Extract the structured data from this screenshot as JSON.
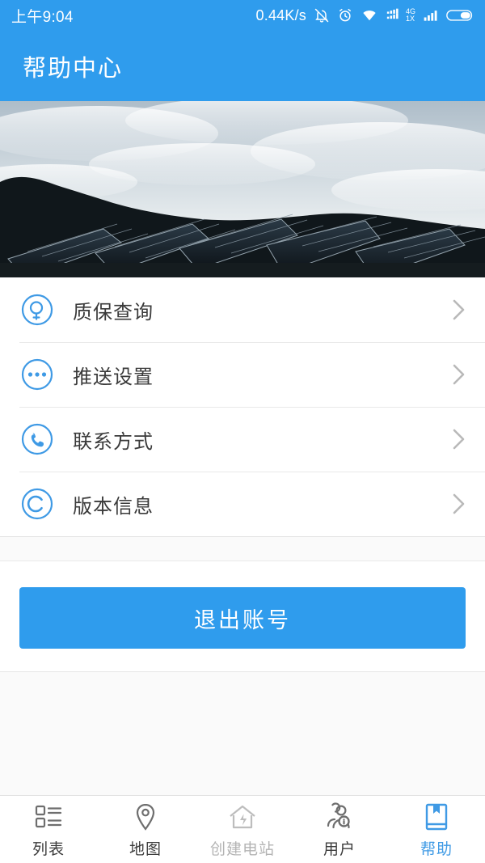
{
  "statusbar": {
    "time": "上午9:04",
    "net_speed": "0.44K/s",
    "icons": [
      "bell-muted-icon",
      "alarm-icon",
      "wifi-icon",
      "signal-1-icon",
      "signal-2-icon",
      "battery-icon"
    ],
    "network_label_top": "4G",
    "network_label_bottom": "1X"
  },
  "header": {
    "title": "帮助中心",
    "background_color": "#2f9ced"
  },
  "banner": {
    "alt": "solar-panel-farm-photo"
  },
  "menu": {
    "items": [
      {
        "label": "质保查询",
        "icon": "search-circle-icon"
      },
      {
        "label": "推送设置",
        "icon": "dots-circle-icon"
      },
      {
        "label": "联系方式",
        "icon": "phone-circle-icon"
      },
      {
        "label": "版本信息",
        "icon": "copyright-circle-icon"
      }
    ],
    "chevron_icon": "chevron-right-icon",
    "icon_color": "#3f9ae5",
    "label_color": "#3a3a3a"
  },
  "logout": {
    "label": "退出账号",
    "color": "#2f9ced"
  },
  "tabbar": {
    "items": [
      {
        "label": "列表",
        "icon": "list-icon",
        "state": "normal"
      },
      {
        "label": "地图",
        "icon": "map-pin-icon",
        "state": "normal"
      },
      {
        "label": "创建电站",
        "icon": "house-bolt-icon",
        "state": "dim"
      },
      {
        "label": "用户",
        "icon": "users-info-icon",
        "state": "normal"
      },
      {
        "label": "帮助",
        "icon": "book-bookmark-icon",
        "state": "active"
      }
    ],
    "active_color": "#3f9ae5"
  }
}
